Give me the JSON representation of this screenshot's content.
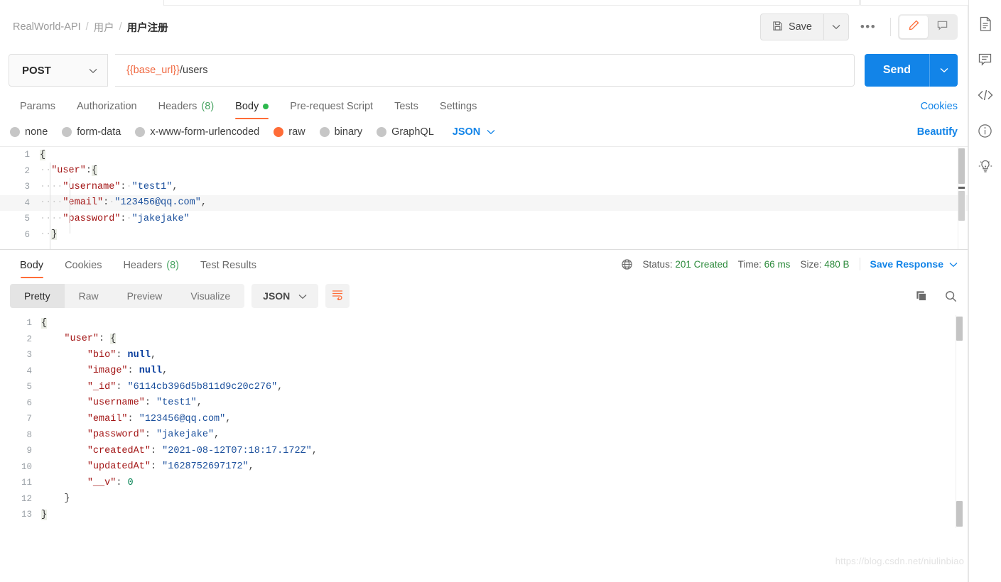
{
  "header": {
    "breadcrumb": [
      "RealWorld-API",
      "用户",
      "用户注册"
    ],
    "separator": "/",
    "save_label": "Save",
    "more_label": "•••",
    "icons": {
      "save": "floppy-disk-icon",
      "caret": "chevron-down-icon",
      "edit": "pencil-icon",
      "comment": "comment-icon"
    }
  },
  "request": {
    "method": "POST",
    "url_variable": "{{base_url}}",
    "url_path": "/users",
    "send_label": "Send",
    "tabs": [
      {
        "label": "Params",
        "count": "",
        "active": false,
        "dot": false
      },
      {
        "label": "Authorization",
        "count": "",
        "active": false,
        "dot": false
      },
      {
        "label": "Headers",
        "count": "(8)",
        "active": false,
        "dot": false
      },
      {
        "label": "Body",
        "count": "",
        "active": true,
        "dot": true
      },
      {
        "label": "Pre-request Script",
        "count": "",
        "active": false,
        "dot": false
      },
      {
        "label": "Tests",
        "count": "",
        "active": false,
        "dot": false
      },
      {
        "label": "Settings",
        "count": "",
        "active": false,
        "dot": false
      }
    ],
    "cookies_link": "Cookies",
    "body_types": [
      {
        "label": "none",
        "selected": false
      },
      {
        "label": "form-data",
        "selected": false
      },
      {
        "label": "x-www-form-urlencoded",
        "selected": false
      },
      {
        "label": "raw",
        "selected": true
      },
      {
        "label": "binary",
        "selected": false
      },
      {
        "label": "GraphQL",
        "selected": false
      }
    ],
    "format": "JSON",
    "beautify_label": "Beautify",
    "body_lines": [
      {
        "n": "1",
        "tokens": [
          {
            "t": "{",
            "c": "brc"
          }
        ]
      },
      {
        "n": "2",
        "tokens": [
          {
            "t": "··",
            "c": "ws"
          },
          {
            "t": "\"user\"",
            "c": "k"
          },
          {
            "t": ":",
            "c": "p"
          },
          {
            "t": "{",
            "c": "brc"
          }
        ]
      },
      {
        "n": "3",
        "tokens": [
          {
            "t": "····",
            "c": "ws"
          },
          {
            "t": "\"username\"",
            "c": "k"
          },
          {
            "t": ":",
            "c": "p"
          },
          {
            "t": "·",
            "c": "ws"
          },
          {
            "t": "\"test1\"",
            "c": "s"
          },
          {
            "t": ",",
            "c": "p"
          }
        ]
      },
      {
        "n": "4",
        "tokens": [
          {
            "t": "····",
            "c": "ws"
          },
          {
            "t": "\"email\"",
            "c": "k"
          },
          {
            "t": ":",
            "c": "p"
          },
          {
            "t": "·",
            "c": "ws"
          },
          {
            "t": "\"123456@qq.com\"",
            "c": "s"
          },
          {
            "t": ",",
            "c": "p"
          }
        ]
      },
      {
        "n": "5",
        "tokens": [
          {
            "t": "····",
            "c": "ws"
          },
          {
            "t": "\"password\"",
            "c": "k"
          },
          {
            "t": ":",
            "c": "p"
          },
          {
            "t": "·",
            "c": "ws"
          },
          {
            "t": "\"jakejake\"",
            "c": "s"
          }
        ]
      },
      {
        "n": "6",
        "tokens": [
          {
            "t": "··",
            "c": "ws"
          },
          {
            "t": "}",
            "c": "brc"
          }
        ]
      }
    ]
  },
  "response": {
    "tabs": [
      {
        "label": "Body",
        "count": "",
        "active": true
      },
      {
        "label": "Cookies",
        "count": "",
        "active": false
      },
      {
        "label": "Headers",
        "count": "(8)",
        "active": false
      },
      {
        "label": "Test Results",
        "count": "",
        "active": false
      }
    ],
    "status_label": "Status:",
    "status_value": "201 Created",
    "time_label": "Time:",
    "time_value": "66 ms",
    "size_label": "Size:",
    "size_value": "480 B",
    "save_response_label": "Save Response",
    "view_modes": [
      {
        "label": "Pretty",
        "active": true
      },
      {
        "label": "Raw",
        "active": false
      },
      {
        "label": "Preview",
        "active": false
      },
      {
        "label": "Visualize",
        "active": false
      }
    ],
    "format": "JSON",
    "icons": {
      "wrap": "word-wrap-icon",
      "copy": "copy-icon",
      "search": "search-icon",
      "globe": "globe-icon"
    },
    "body_lines": [
      {
        "n": "1",
        "tokens": [
          {
            "t": "{",
            "c": "brc"
          }
        ]
      },
      {
        "n": "2",
        "tokens": [
          {
            "t": "    ",
            "c": "p"
          },
          {
            "t": "\"user\"",
            "c": "k"
          },
          {
            "t": ": ",
            "c": "p"
          },
          {
            "t": "{",
            "c": "brc"
          }
        ]
      },
      {
        "n": "3",
        "tokens": [
          {
            "t": "        ",
            "c": "p"
          },
          {
            "t": "\"bio\"",
            "c": "k"
          },
          {
            "t": ": ",
            "c": "p"
          },
          {
            "t": "null",
            "c": "nl"
          },
          {
            "t": ",",
            "c": "p"
          }
        ]
      },
      {
        "n": "4",
        "tokens": [
          {
            "t": "        ",
            "c": "p"
          },
          {
            "t": "\"image\"",
            "c": "k"
          },
          {
            "t": ": ",
            "c": "p"
          },
          {
            "t": "null",
            "c": "nl"
          },
          {
            "t": ",",
            "c": "p"
          }
        ]
      },
      {
        "n": "5",
        "tokens": [
          {
            "t": "        ",
            "c": "p"
          },
          {
            "t": "\"_id\"",
            "c": "k"
          },
          {
            "t": ": ",
            "c": "p"
          },
          {
            "t": "\"6114cb396d5b811d9c20c276\"",
            "c": "s"
          },
          {
            "t": ",",
            "c": "p"
          }
        ]
      },
      {
        "n": "6",
        "tokens": [
          {
            "t": "        ",
            "c": "p"
          },
          {
            "t": "\"username\"",
            "c": "k"
          },
          {
            "t": ": ",
            "c": "p"
          },
          {
            "t": "\"test1\"",
            "c": "s"
          },
          {
            "t": ",",
            "c": "p"
          }
        ]
      },
      {
        "n": "7",
        "tokens": [
          {
            "t": "        ",
            "c": "p"
          },
          {
            "t": "\"email\"",
            "c": "k"
          },
          {
            "t": ": ",
            "c": "p"
          },
          {
            "t": "\"123456@qq.com\"",
            "c": "s"
          },
          {
            "t": ",",
            "c": "p"
          }
        ]
      },
      {
        "n": "8",
        "tokens": [
          {
            "t": "        ",
            "c": "p"
          },
          {
            "t": "\"password\"",
            "c": "k"
          },
          {
            "t": ": ",
            "c": "p"
          },
          {
            "t": "\"jakejake\"",
            "c": "s"
          },
          {
            "t": ",",
            "c": "p"
          }
        ]
      },
      {
        "n": "9",
        "tokens": [
          {
            "t": "        ",
            "c": "p"
          },
          {
            "t": "\"createdAt\"",
            "c": "k"
          },
          {
            "t": ": ",
            "c": "p"
          },
          {
            "t": "\"2021-08-12T07:18:17.172Z\"",
            "c": "s"
          },
          {
            "t": ",",
            "c": "p"
          }
        ]
      },
      {
        "n": "10",
        "tokens": [
          {
            "t": "        ",
            "c": "p"
          },
          {
            "t": "\"updatedAt\"",
            "c": "k"
          },
          {
            "t": ": ",
            "c": "p"
          },
          {
            "t": "\"1628752697172\"",
            "c": "s"
          },
          {
            "t": ",",
            "c": "p"
          }
        ]
      },
      {
        "n": "11",
        "tokens": [
          {
            "t": "        ",
            "c": "p"
          },
          {
            "t": "\"__v\"",
            "c": "k"
          },
          {
            "t": ": ",
            "c": "p"
          },
          {
            "t": "0",
            "c": "n"
          }
        ]
      },
      {
        "n": "12",
        "tokens": [
          {
            "t": "    ",
            "c": "p"
          },
          {
            "t": "}",
            "c": "p"
          }
        ]
      },
      {
        "n": "13",
        "tokens": [
          {
            "t": "}",
            "c": "brc"
          }
        ]
      }
    ]
  },
  "right_rail": [
    {
      "icon": "document-icon"
    },
    {
      "icon": "comment-icon"
    },
    {
      "icon": "code-icon"
    },
    {
      "icon": "info-icon"
    },
    {
      "icon": "lightbulb-icon"
    }
  ],
  "watermark": "https://blog.csdn.net/niulinbiao",
  "colors": {
    "accent": "#ff6c37",
    "link": "#1284e8",
    "success": "#2e8b3d",
    "send": "#1284e8"
  }
}
